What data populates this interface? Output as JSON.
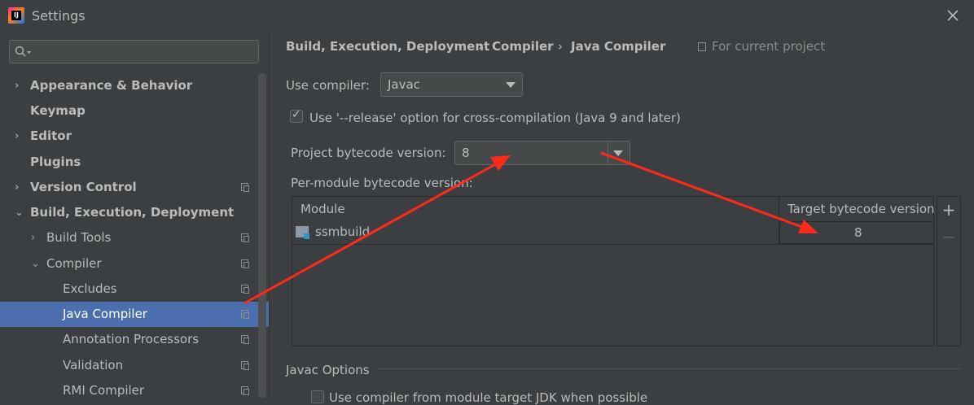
{
  "window": {
    "title": "Settings"
  },
  "search": {
    "placeholder": "",
    "value": ""
  },
  "sidebar": {
    "items": [
      {
        "label": "Appearance & Behavior",
        "expand": "›",
        "bold": true
      },
      {
        "label": "Keymap",
        "bold": true
      },
      {
        "label": "Editor",
        "expand": "›",
        "bold": true
      },
      {
        "label": "Plugins",
        "bold": true
      },
      {
        "label": "Version Control",
        "expand": "›",
        "bold": true,
        "project_icon": true
      },
      {
        "label": "Build, Execution, Deployment",
        "expand": "⌄",
        "bold": true
      },
      {
        "label": "Build Tools",
        "expand": "›",
        "project_icon": true
      },
      {
        "label": "Compiler",
        "expand": "⌄",
        "project_icon": true
      },
      {
        "label": "Excludes",
        "project_icon": true
      },
      {
        "label": "Java Compiler",
        "project_icon": true,
        "selected": true
      },
      {
        "label": "Annotation Processors",
        "project_icon": true
      },
      {
        "label": "Validation",
        "project_icon": true
      },
      {
        "label": "RMI Compiler",
        "project_icon": true
      }
    ]
  },
  "breadcrumb": {
    "parts": [
      "Build, Execution, Deployment",
      "Compiler",
      "Java Compiler"
    ],
    "separator": "›",
    "scope": "For current project"
  },
  "compiler": {
    "use_compiler_label": "Use compiler:",
    "use_compiler_value": "Javac",
    "release_option_label": "Use '--release' option for cross-compilation (Java 9 and later)",
    "release_option_checked": true,
    "project_bytecode_label": "Project bytecode version:",
    "project_bytecode_value": "8",
    "per_module_label": "Per-module bytecode version:"
  },
  "module_table": {
    "headers": [
      "Module",
      "Target bytecode version"
    ],
    "rows": [
      {
        "module": "ssmbuild",
        "version": "8"
      }
    ],
    "add_label": "+",
    "remove_label": "−"
  },
  "javac_options": {
    "section_label": "Javac Options",
    "partial_checkbox_label": "Use compiler from module target JDK when possible"
  },
  "colors": {
    "background": "#3c3f41",
    "selection": "#4b6eaf",
    "annotation_arrow": "#ff2a1a"
  },
  "icons": {
    "close": "close-icon",
    "search": "search-icon",
    "app": "intellij-app-icon",
    "project_scope": "copy-icon",
    "module": "module-folder-icon"
  }
}
